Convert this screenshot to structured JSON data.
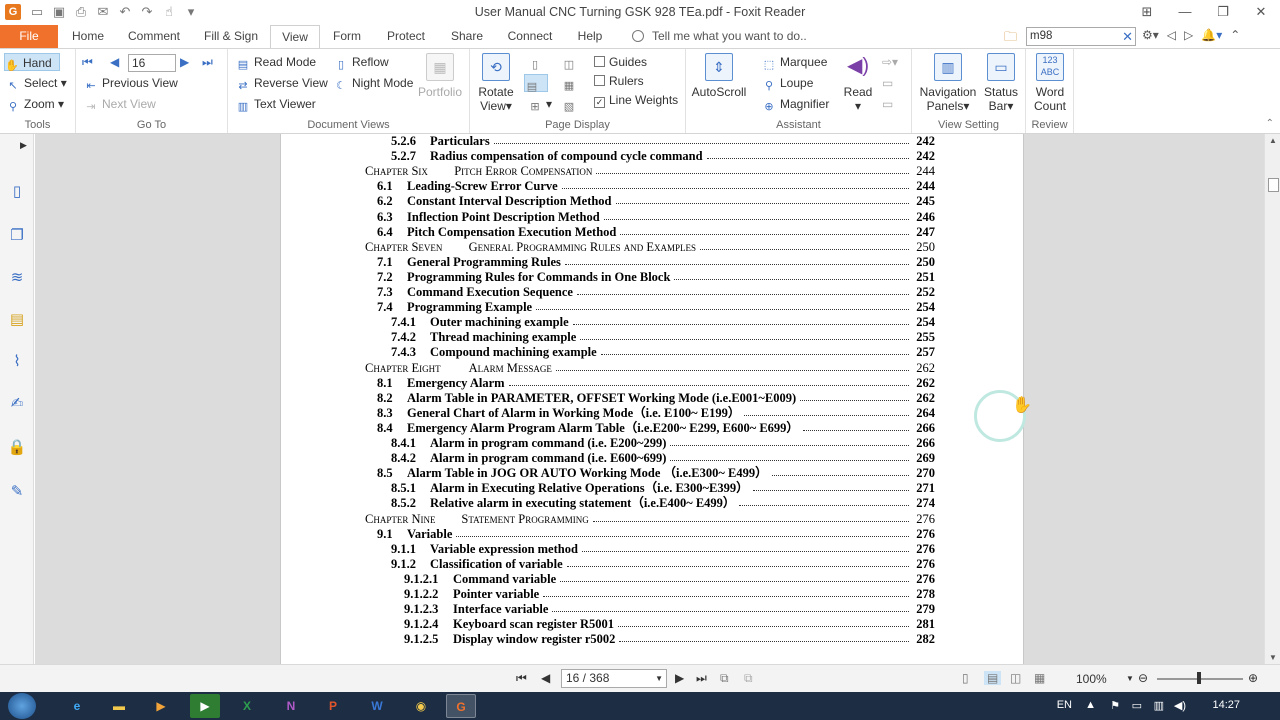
{
  "window": {
    "title": "User Manual CNC Turning GSK 928 TEa.pdf - Foxit Reader",
    "app_logo": "G"
  },
  "tabs": [
    "File",
    "Home",
    "Comment",
    "Fill & Sign",
    "View",
    "Form",
    "Protect",
    "Share",
    "Connect",
    "Help"
  ],
  "active_tab": "View",
  "tell_me_placeholder": "Tell me what you want to do..",
  "search": {
    "value": "m98"
  },
  "ribbon": {
    "tools": {
      "label": "Tools",
      "hand": "Hand",
      "select": "Select",
      "zoom": "Zoom"
    },
    "goto": {
      "label": "Go To",
      "page_value": "16",
      "previous_view": "Previous View",
      "next_view": "Next View"
    },
    "document_views": {
      "label": "Document Views",
      "read_mode": "Read Mode",
      "reverse_view": "Reverse View",
      "text_viewer": "Text Viewer",
      "reflow": "Reflow",
      "night_mode": "Night Mode",
      "portfolio": "Portfolio"
    },
    "page_display": {
      "label": "Page Display",
      "rotate_view_1": "Rotate",
      "rotate_view_2": "View",
      "guides": "Guides",
      "rulers": "Rulers",
      "line_weights": "Line Weights",
      "line_weights_checked": true
    },
    "assistant": {
      "label": "Assistant",
      "autoscroll": "AutoScroll",
      "marquee": "Marquee",
      "loupe": "Loupe",
      "magnifier": "Magnifier",
      "read": "Read"
    },
    "view_setting": {
      "label": "View Setting",
      "nav_panels_1": "Navigation",
      "nav_panels_2": "Panels",
      "status_bar_1": "Status",
      "status_bar_2": "Bar"
    },
    "review": {
      "label": "Review",
      "word_count_1": "Word",
      "word_count_2": "Count",
      "word_count_icon": "123 ABC"
    }
  },
  "toc": [
    {
      "num": "5.2.6",
      "title": "Particulars",
      "page": "242",
      "level": 3
    },
    {
      "num": "5.2.7",
      "title": "Radius compensation of compound cycle command",
      "page": "242",
      "level": 3
    },
    {
      "num": "Chapter Six",
      "title": "Pitch Error Compensation",
      "page": "244",
      "level": 0
    },
    {
      "num": "6.1",
      "title": "Leading-Screw Error Curve",
      "page": "244",
      "level": 2
    },
    {
      "num": "6.2",
      "title": "Constant Interval Description Method",
      "page": "245",
      "level": 2
    },
    {
      "num": "6.3",
      "title": "Inflection Point Description Method",
      "page": "246",
      "level": 2
    },
    {
      "num": "6.4",
      "title": "Pitch Compensation Execution Method",
      "page": "247",
      "level": 2
    },
    {
      "num": "Chapter Seven",
      "title": "General Programming Rules and Examples",
      "page": "250",
      "level": 0
    },
    {
      "num": "7.1",
      "title": "General Programming Rules",
      "page": "250",
      "level": 2
    },
    {
      "num": "7.2",
      "title": "Programming Rules for Commands in One Block",
      "page": "251",
      "level": 2
    },
    {
      "num": "7.3",
      "title": "Command Execution Sequence",
      "page": "252",
      "level": 2
    },
    {
      "num": "7.4",
      "title": "Programming Example",
      "page": "254",
      "level": 2
    },
    {
      "num": "7.4.1",
      "title": "Outer machining example",
      "page": "254",
      "level": 3
    },
    {
      "num": "7.4.2",
      "title": "Thread machining example",
      "page": "255",
      "level": 3
    },
    {
      "num": "7.4.3",
      "title": "Compound machining example",
      "page": "257",
      "level": 3
    },
    {
      "num": "Chapter Eight",
      "title": "Alarm Message",
      "page": "262",
      "level": 0
    },
    {
      "num": "8.1",
      "title": "Emergency Alarm",
      "page": "262",
      "level": 2
    },
    {
      "num": "8.2",
      "title": "Alarm Table in PARAMETER, OFFSET Working Mode (i.e.E001~E009)",
      "page": "262",
      "level": 2
    },
    {
      "num": "8.3",
      "title": "General Chart of Alarm in Working Mode（i.e. E100~ E199）",
      "page": "264",
      "level": 2
    },
    {
      "num": "8.4",
      "title": "Emergency Alarm Program Alarm Table（i.e.E200~ E299, E600~ E699）",
      "page": "266",
      "level": 2
    },
    {
      "num": "8.4.1",
      "title": "Alarm in program command (i.e. E200~299)",
      "page": "266",
      "level": 3
    },
    {
      "num": "8.4.2",
      "title": "Alarm in program command (i.e. E600~699)",
      "page": "269",
      "level": 3
    },
    {
      "num": "8.5",
      "title": "Alarm Table in JOG OR AUTO Working Mode （i.e.E300~ E499）",
      "page": "270",
      "level": 2
    },
    {
      "num": "8.5.1",
      "title": "Alarm in Executing Relative Operations（i.e. E300~E399）",
      "page": "271",
      "level": 3
    },
    {
      "num": "8.5.2",
      "title": "Relative alarm in executing statement（i.e.E400~ E499）",
      "page": "274",
      "level": 3
    },
    {
      "num": "Chapter Nine",
      "title": "Statement Programming",
      "page": "276",
      "level": 0
    },
    {
      "num": "9.1",
      "title": "Variable",
      "page": "276",
      "level": 2
    },
    {
      "num": "9.1.1",
      "title": "Variable expression method",
      "page": "276",
      "level": 3
    },
    {
      "num": "9.1.2",
      "title": "Classification of variable",
      "page": "276",
      "level": 3
    },
    {
      "num": "9.1.2.1",
      "title": "Command variable",
      "page": "276",
      "level": 4
    },
    {
      "num": "9.1.2.2",
      "title": "Pointer variable",
      "page": "278",
      "level": 4
    },
    {
      "num": "9.1.2.3",
      "title": "Interface variable",
      "page": "279",
      "level": 4
    },
    {
      "num": "9.1.2.4",
      "title": "Keyboard scan register R5001",
      "page": "281",
      "level": 4
    },
    {
      "num": "9.1.2.5",
      "title": "Display window register r5002",
      "page": "282",
      "level": 4
    }
  ],
  "statusbar": {
    "page_indicator": "16 / 368",
    "zoom": "100%"
  },
  "taskbar": {
    "apps": [
      "IE",
      "Explorer",
      "Media",
      "Sheets",
      "Excel",
      "OneNote",
      "PowerPoint",
      "Word",
      "Chrome",
      "Foxit"
    ],
    "lang": "EN",
    "time": "14:27"
  }
}
